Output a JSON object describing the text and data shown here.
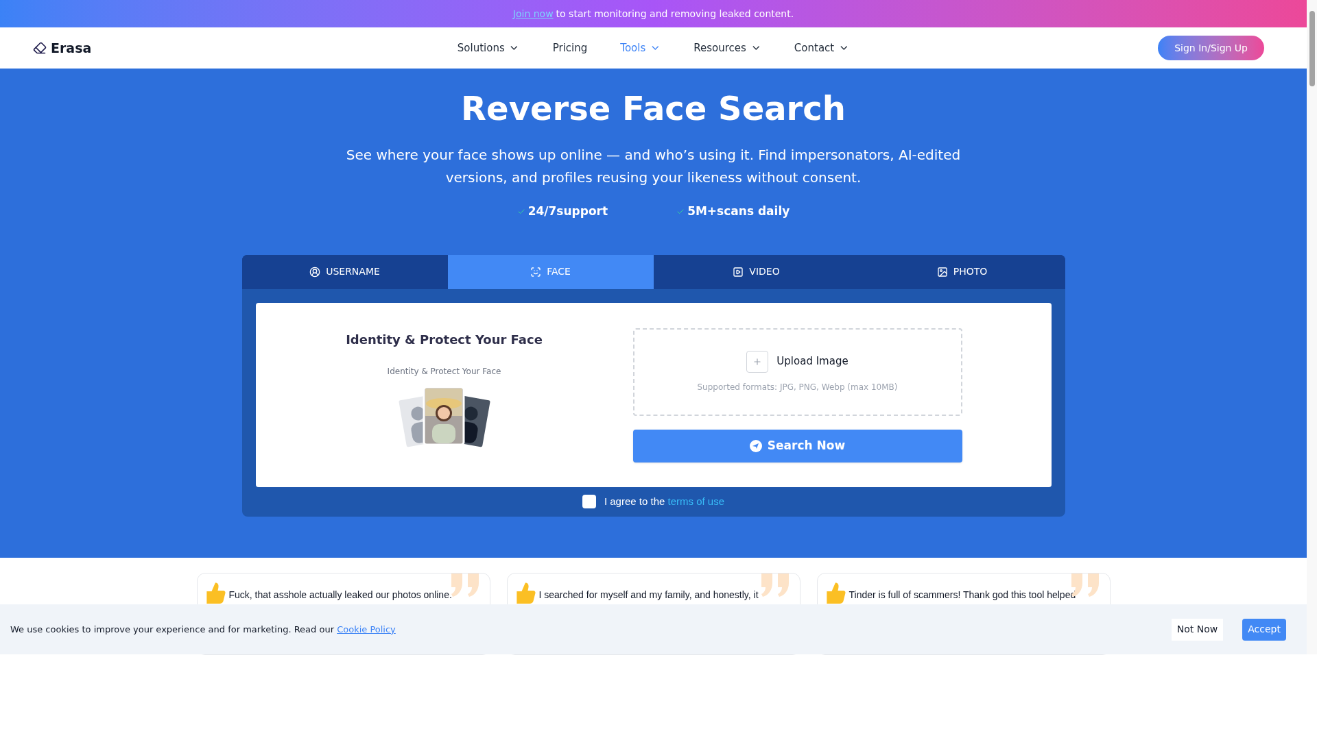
{
  "banner": {
    "link": "Join now",
    "text": "to start monitoring and removing leaked content."
  },
  "nav": {
    "logo": "Erasa",
    "items": [
      {
        "label": "Solutions",
        "dropdown": true,
        "selected": false
      },
      {
        "label": "Pricing",
        "dropdown": false,
        "selected": false
      },
      {
        "label": "Tools",
        "dropdown": true,
        "selected": true
      },
      {
        "label": "Resources",
        "dropdown": true,
        "selected": false
      },
      {
        "label": "Contact",
        "dropdown": true,
        "selected": false
      }
    ],
    "signin": "Sign In/Sign Up"
  },
  "hero": {
    "title": "Reverse Face Search",
    "subtitle": "See where your face shows up online — and who’s using it. Find impersonators, AI-edited versions, and profiles reusing your likeness without consent.",
    "features": [
      "24/7support",
      "5M+scans daily"
    ]
  },
  "tabs": [
    {
      "label": "USERNAME",
      "kind": "user",
      "selected": false
    },
    {
      "label": "FACE",
      "kind": "face",
      "selected": true
    },
    {
      "label": "VIDEO",
      "kind": "video",
      "selected": false
    },
    {
      "label": "PHOTO",
      "selected": false
    }
  ],
  "panel": {
    "title": "Identity & Protect Your Face",
    "caption": "Identity & Protect Your Face",
    "upload": "Upload Image",
    "formats": "Supported formats: JPG, PNG, Webp (max 10MB)",
    "button": "Search Now",
    "agree": {
      "text": "I agree to the",
      "link": "terms of use",
      "checked": false
    }
  },
  "testimonials": [
    {
      "text": "Fuck, that asshole actually leaked our photos online."
    },
    {
      "text": "I searched for myself and my family, and honestly, it"
    },
    {
      "text": "Tinder is full of scammers! Thank god this tool helped"
    }
  ],
  "cookie": {
    "text": "We use cookies to improve your experience and for marketing. Read our",
    "link": "Cookie Policy",
    "decline": "Not Now",
    "accept": "Accept"
  }
}
